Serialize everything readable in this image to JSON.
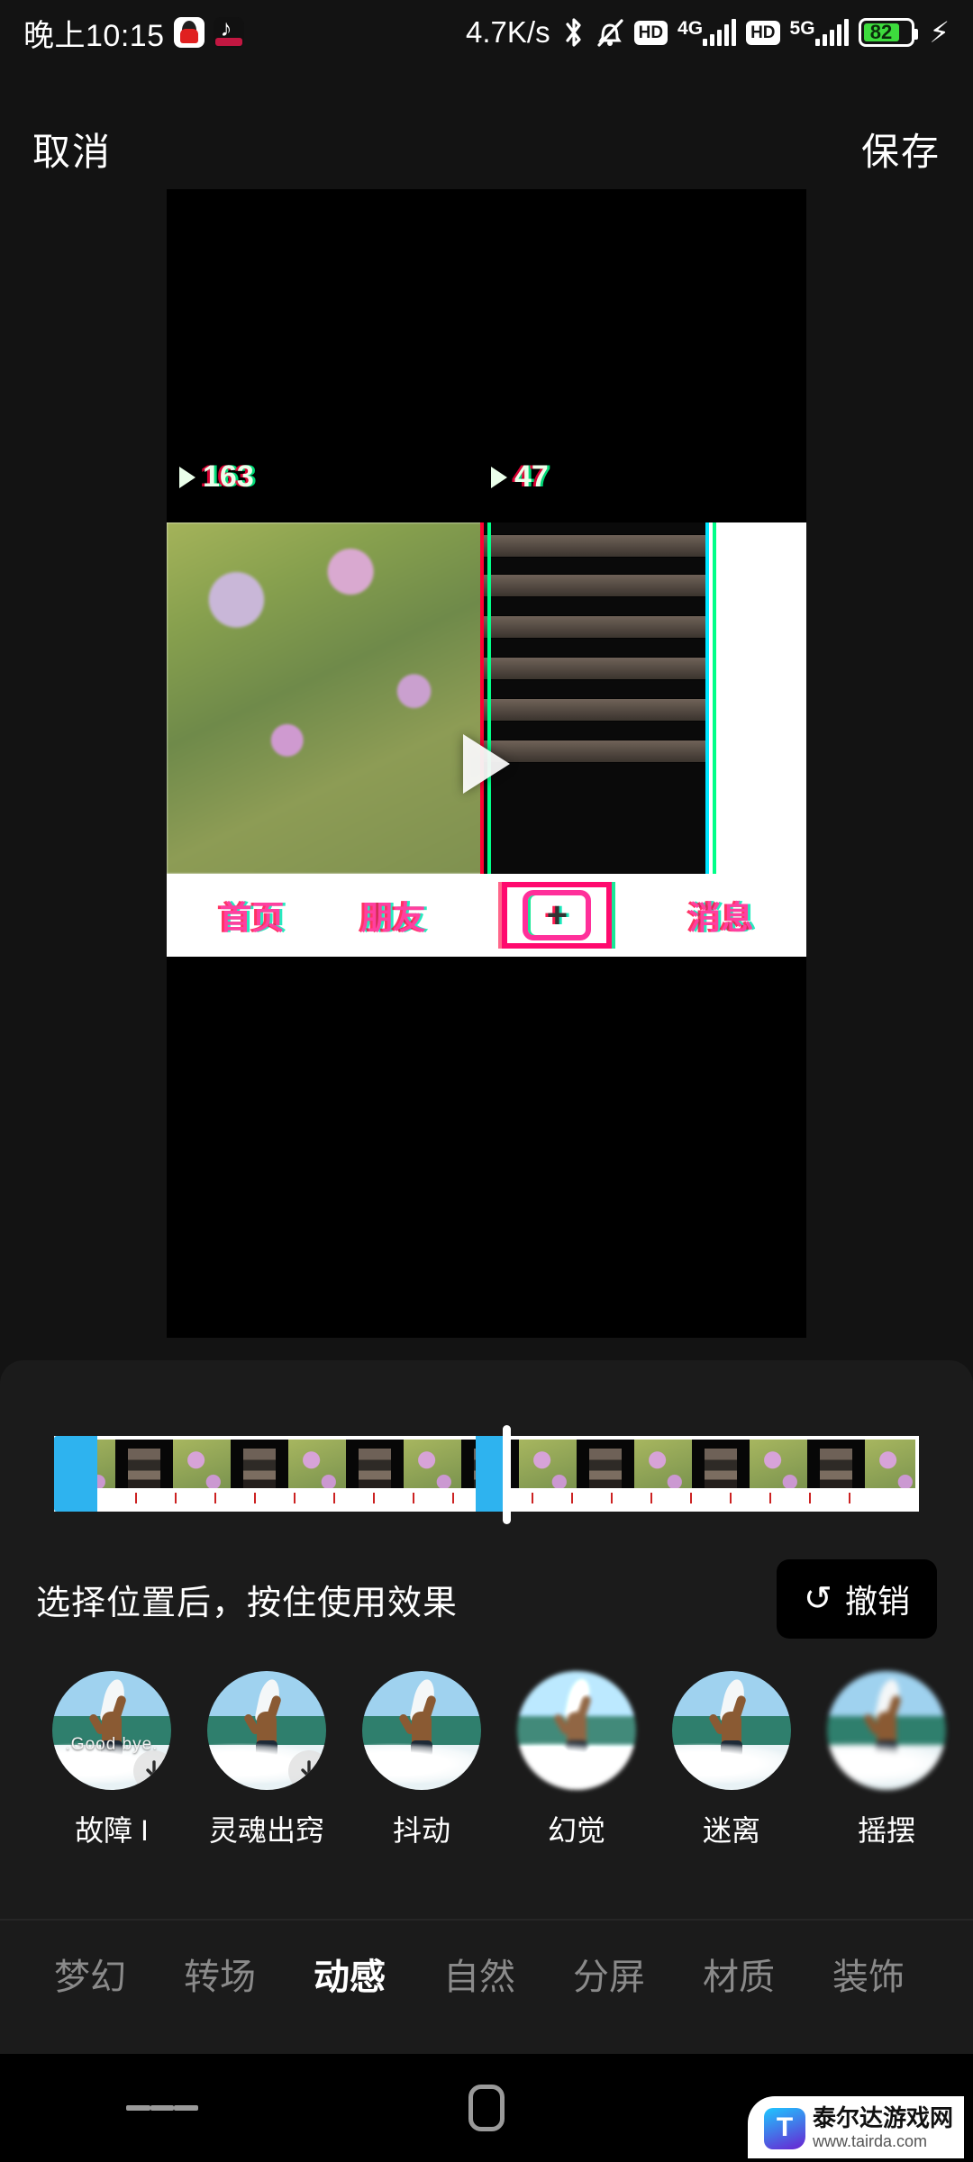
{
  "statusbar": {
    "time": "晚上10:15",
    "app_icons": [
      "qq-icon",
      "tiktok-icon"
    ],
    "network_speed": "4.7K/s",
    "icons": [
      "bluetooth-icon",
      "mute-icon"
    ],
    "sim1": {
      "hd": "HD",
      "gen": "4G"
    },
    "sim2": {
      "hd": "HD",
      "gen": "5G"
    },
    "battery": {
      "level": "82",
      "color": "#3ddb3d",
      "charging": true
    }
  },
  "header": {
    "cancel_label": "取消",
    "save_label": "保存"
  },
  "preview": {
    "counts": [
      "163",
      "47"
    ],
    "video_nav": [
      "首页",
      "朋友",
      "消息"
    ],
    "plus_label": "+",
    "play_icon": "play-icon"
  },
  "panel": {
    "hint": "选择位置后，按住使用效果",
    "undo_label": "撤销",
    "undo_icon": "undo-icon",
    "timeline": {
      "selection_start_percent": 0,
      "selection_end_percent": 52,
      "playhead_percent": 53
    },
    "effects": [
      {
        "label": "故障 I",
        "overlay_text": ".Good bye.",
        "selected": true
      },
      {
        "label": "灵魂出窍",
        "selected": true
      },
      {
        "label": "抖动",
        "selected": false
      },
      {
        "label": "幻觉",
        "selected": false
      },
      {
        "label": "迷离",
        "selected": false
      },
      {
        "label": "摇摆",
        "selected": false
      }
    ],
    "categories": [
      {
        "label": "梦幻",
        "active": false
      },
      {
        "label": "转场",
        "active": false
      },
      {
        "label": "动感",
        "active": true
      },
      {
        "label": "自然",
        "active": false
      },
      {
        "label": "分屏",
        "active": false
      },
      {
        "label": "材质",
        "active": false
      },
      {
        "label": "装饰",
        "active": false
      }
    ]
  },
  "navbar": {
    "items": [
      "menu-icon",
      "home-icon",
      "back-icon"
    ]
  },
  "watermark": {
    "site_name": "泰尔达游戏网",
    "site_url": "www.tairda.com"
  },
  "colors": {
    "accent_blue": "#2eb3ef",
    "battery_green": "#3ddb3d",
    "panel_bg": "#1b1b1b",
    "page_bg": "#131313"
  }
}
